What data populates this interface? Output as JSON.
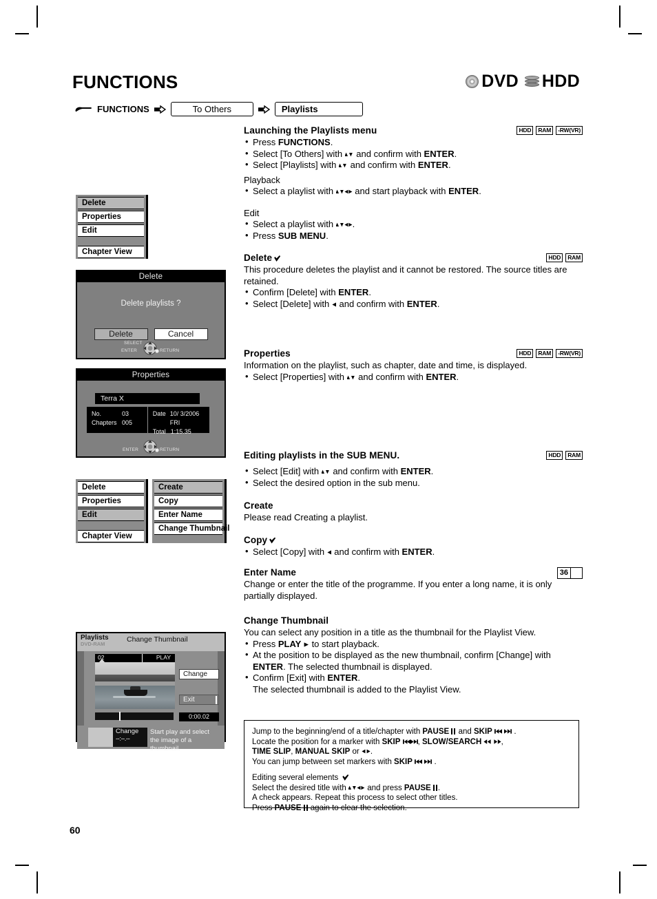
{
  "page": {
    "title": "FUNCTIONS",
    "number": "60"
  },
  "media_logos": [
    {
      "icon": "disc-icon",
      "label": "DVD"
    },
    {
      "icon": "hdd-icon",
      "label": "HDD"
    }
  ],
  "breadcrumb": {
    "hand_icon": "pointing-hand-icon",
    "root": "FUNCTIONS",
    "steps": [
      "To Others",
      "Playlists"
    ]
  },
  "sections": {
    "launching": {
      "heading": "Launching the Playlists menu",
      "badges": [
        "HDD",
        "RAM",
        "-RW(VR)"
      ],
      "bullets": [
        "Press FUNCTIONS.",
        "Select [To Others] with ▲▼ and confirm with ENTER.",
        "Select [Playlists] with ▲▼ and confirm with ENTER."
      ],
      "playback_label": "Playback",
      "playback_bullet": "Select a playlist with ▲▼◀▶ and start playback with ENTER.",
      "edit_label": "Edit",
      "edit_bullets": [
        "Select a playlist with ▲▼◀▶.",
        "Press SUB MENU."
      ]
    },
    "delete": {
      "heading": "Delete",
      "has_check_glyph": true,
      "badges": [
        "HDD",
        "RAM"
      ],
      "body": "This procedure deletes the playlist and it cannot be restored. The source titles are retained.",
      "bullets": [
        "Confirm [Delete] with ENTER.",
        "Select [Delete] with ◀ and confirm with ENTER."
      ]
    },
    "properties": {
      "heading": "Properties",
      "badges": [
        "HDD",
        "RAM",
        "-RW(VR)"
      ],
      "body": "Information on the playlist, such as chapter, date and time, is displayed.",
      "bullets": [
        "Select [Properties] with ▲▼ and confirm with ENTER."
      ]
    },
    "editing": {
      "heading": "Editing playlists in the SUB MENU.",
      "badges": [
        "HDD",
        "RAM"
      ],
      "bullets": [
        "Select [Edit] with ▲▼ and confirm with ENTER.",
        "Select the desired option in the sub menu."
      ]
    },
    "create": {
      "heading": "Create",
      "body": "Please read Creating a playlist."
    },
    "copy": {
      "heading": "Copy",
      "has_check_glyph": true,
      "bullets": [
        "Select [Copy] with ◀ and confirm with ENTER."
      ]
    },
    "enter_name": {
      "heading": "Enter Name",
      "book_ref": "36",
      "body": "Change or enter the title of the programme. If you enter a long name, it is only partially displayed."
    },
    "change_thumbnail": {
      "heading": "Change Thumbnail",
      "body": "You can select any position in a title as the thumbnail for the Playlist View.",
      "bullets": [
        "Press PLAY ▶  to start playback.",
        "At the position to be displayed as the new thumbnail, confirm [Change] with ENTER. The selected thumbnail is displayed.",
        "Confirm [Exit] with ENTER."
      ],
      "trailing_line": "The selected thumbnail is added to the Playlist View."
    }
  },
  "notebox": {
    "block1": [
      "Jump to the beginning/end of a title/chapter with PAUSE ❙❙ and SKIP ⏮ ⏭ .",
      "Locate the position for a marker with SKIP ⏮ ⏭, SLOW/SEARCH ◀◀ ▶▶,",
      "TIME SLIP, MANUAL SKIP or ◀▶.",
      "You can jump between set markers with SKIP ⏮ ⏭ ."
    ],
    "block2_title": "Editing several elements",
    "block2": [
      "Select the desired title with ▲▼◀▶ and press PAUSE ❙❙.",
      "A check appears. Repeat this process to select other titles.",
      "Press PAUSE ❙❙ again to clear the selection."
    ]
  },
  "illustrations": {
    "menu1": {
      "items": [
        {
          "label": "Delete",
          "selected": true
        },
        {
          "label": "Properties",
          "selected": false
        },
        {
          "label": "Edit",
          "selected": false
        },
        {
          "label": "Chapter View",
          "selected": false
        }
      ]
    },
    "delete_dialog": {
      "title": "Delete",
      "message": "Delete playlists ?",
      "buttons": [
        {
          "label": "Delete",
          "selected": true
        },
        {
          "label": "Cancel",
          "selected": false
        }
      ],
      "hints": {
        "select": "SELECT",
        "enter": "ENTER",
        "return": "RETURN"
      }
    },
    "properties_dialog": {
      "title": "Properties",
      "name": "Terra X",
      "fields": [
        {
          "key": "No.",
          "value": "03"
        },
        {
          "key": "Chapters",
          "value": "005"
        },
        {
          "key": "Date",
          "value": "10/ 3/2006 FRI"
        },
        {
          "key": "Total",
          "value": "1:15.35"
        }
      ],
      "hints": {
        "enter": "ENTER",
        "return": "RETURN"
      }
    },
    "menu2": {
      "items": [
        {
          "label": "Delete",
          "selected": false
        },
        {
          "label": "Properties",
          "selected": false
        },
        {
          "label": "Edit",
          "selected": true
        },
        {
          "label": "Chapter View",
          "selected": false
        }
      ]
    },
    "submenu": {
      "items": [
        {
          "label": "Create",
          "selected": true
        },
        {
          "label": "Copy",
          "selected": false
        },
        {
          "label": "Enter Name",
          "selected": false
        },
        {
          "label": "Change Thumbnail",
          "selected": false
        }
      ]
    },
    "thumbnail_screen": {
      "header_left": "Playlists",
      "header_media": "DVD-RAM",
      "header_title": "Change Thumbnail",
      "video_number": "02",
      "video_state": "PLAY",
      "change_button": "Change",
      "exit_button": "Exit",
      "timecode": "0:00.02",
      "footer_label": "Change",
      "footer_time": "--:--.--",
      "footer_desc": "Start play and select the image of a thumbnail."
    }
  }
}
